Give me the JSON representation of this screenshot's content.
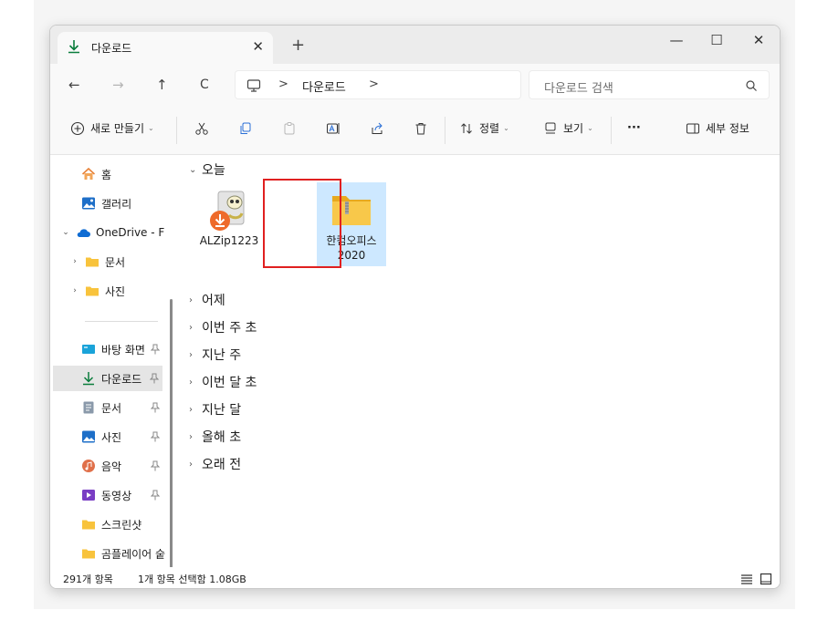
{
  "tab": {
    "title": "다운로드",
    "close": "✕",
    "new_tab": "+"
  },
  "window_controls": {
    "minimize": "—",
    "maximize": "☐",
    "close": "✕"
  },
  "nav": {
    "back": "←",
    "forward": "→",
    "up": "↑",
    "refresh": "C"
  },
  "address": {
    "sep1": ">",
    "crumb": "다운로드",
    "sep2": ">"
  },
  "search": {
    "placeholder": "다운로드 검색"
  },
  "toolbar": {
    "new_label": "새로 만들기",
    "sort_label": "정렬",
    "view_label": "보기",
    "more_label": "···",
    "details_label": "세부 정보",
    "chev": "⌄"
  },
  "sidebar": {
    "home": "홈",
    "gallery": "갤러리",
    "onedrive": "OneDrive - F",
    "onedrive_docs": "문서",
    "onedrive_pics": "사진",
    "desktop": "바탕 화면",
    "downloads": "다운로드",
    "documents": "문서",
    "pictures": "사진",
    "music": "음악",
    "videos": "동영상",
    "screenshots": "스크린샷",
    "gomplayer": "곰플레이어 숱"
  },
  "groups": {
    "today": "오늘",
    "yesterday": "어제",
    "this_week": "이번 주 초",
    "last_week": "지난 주",
    "this_month": "이번 달 초",
    "last_month": "지난 달",
    "this_year": "올해 초",
    "long_ago": "오래 전"
  },
  "files": [
    {
      "name": "ALZip1223"
    },
    {
      "name": "한컴오피스 2020"
    }
  ],
  "status": {
    "count": "291개 항목",
    "selection": "1개 항목 선택함 1.08GB"
  },
  "colors": {
    "accent": "#0a7d3c",
    "folder": "#f8c33c",
    "selection": "#cde8ff",
    "highlight": "#e02020"
  }
}
